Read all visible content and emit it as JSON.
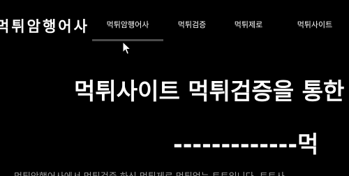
{
  "header": {
    "logo_text": "먹튀암행어사",
    "nav": [
      {
        "label": "먹튀암행어사",
        "active": true
      },
      {
        "label": "먹튀검증",
        "active": false
      },
      {
        "label": "먹튀제로",
        "active": false
      },
      {
        "label": "먹튀사이트",
        "active": false
      }
    ]
  },
  "hero": {
    "title": "먹튀사이트 먹튀검증을 통한",
    "subtitle": "-------------먹"
  },
  "body": {
    "paragraph": "먹튀암행어사에서 먹튀검증 하신 먹튀제로 먹튀없는 토토입니다. 토토사"
  },
  "colors": {
    "background": "#000000",
    "text": "#ffffff",
    "active_underline": "#4a4a4a"
  },
  "icons": {
    "cursor": "mouse-pointer-icon"
  }
}
